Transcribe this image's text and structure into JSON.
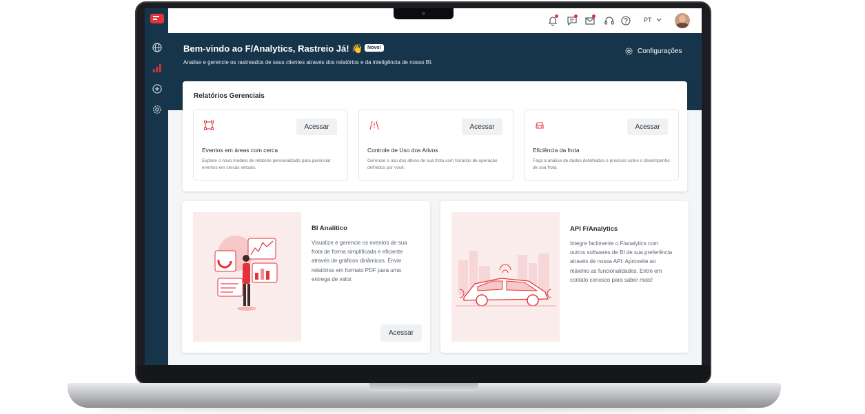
{
  "topbar": {
    "language": "PT",
    "icons": [
      "bell-icon",
      "chat-icon",
      "mail-icon",
      "headset-icon",
      "help-icon"
    ]
  },
  "sidebar": {
    "items": [
      {
        "icon": "globe-icon"
      },
      {
        "icon": "bar-chart-icon",
        "active": true
      },
      {
        "icon": "plus-circle-icon"
      },
      {
        "icon": "gear-icon"
      }
    ]
  },
  "header": {
    "title": "Bem-vindo ao F/Analytics, Rastreio Já! 👋",
    "badge": "Novo!",
    "subtitle": "Analise e gerencie os rastreados de seus clientes através dos relatórios e da inteligência de nosso BI.",
    "settings_label": "Configurações"
  },
  "reports": {
    "title": "Relatórios Gerenciais",
    "items": [
      {
        "icon": "geofence-icon",
        "button": "Acessar",
        "title": "Eventos em áreas com cerca",
        "description": "Explore o novo modelo de relatório personalizado para gerenciar eventos em cercas virtuais."
      },
      {
        "icon": "road-alert-icon",
        "button": "Acessar",
        "title": "Controle de Uso dos Ativos",
        "description": "Gerencie o uso dos ativos de sua frota com horários de operação definidos por você."
      },
      {
        "icon": "car-icon",
        "button": "Acessar",
        "title": "Eficiência da frota",
        "description": "Faça a análise de dados detalhados e  precisos sobre o desempenho de sua frota."
      }
    ]
  },
  "bi": {
    "title": "BI Analítico",
    "description": "Visualize e gerencie os eventos de sua frota de forma simplificada e eficiente através de gráficos dinâmicos. Envie relatórios em formato PDF para uma entrega de valor.",
    "button": "Acessar"
  },
  "api": {
    "title": "API F/Analytics",
    "description": "Integre facilmente o F/analytics com outros softwares de BI de sua preferência através de nossa API. Aproveite ao máximo as funcionalidades. Entre em contato conosco para saber mais!"
  },
  "colors": {
    "navy": "#17354a",
    "accent": "#e53238",
    "illustration_bg": "#fbecec"
  }
}
